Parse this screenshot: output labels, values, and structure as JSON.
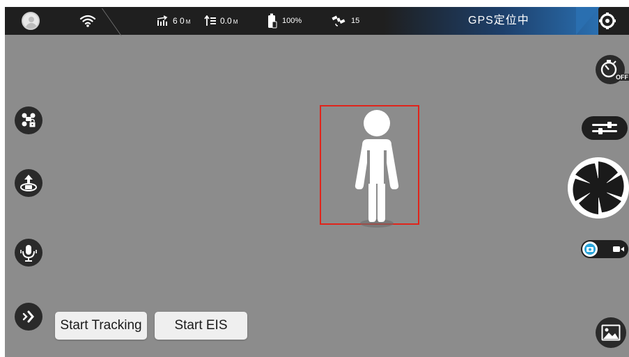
{
  "status_bar": {
    "distance": {
      "value": "6 0",
      "unit": "M",
      "icon": "horizontal-distance-icon"
    },
    "height": {
      "value": "0.0",
      "unit": "M",
      "icon": "altitude-icon"
    },
    "battery": {
      "value": "100%",
      "icon": "battery-icon"
    },
    "satellites": {
      "value": "15",
      "icon": "satellite-icon"
    },
    "gps_status": "GPS定位中",
    "icons": [
      "avatar",
      "wifi-signal-icon",
      "settings-gear-icon"
    ]
  },
  "left_controls": [
    "drone-lock-icon",
    "takeoff-landing-icon",
    "voice-control-icon",
    "expand-chevron-icon"
  ],
  "right_controls": {
    "timer_icon": "timer-icon",
    "timer_state": "OFF",
    "adjust_icon": "sliders-icon",
    "shutter_icon": "aperture-shutter-icon",
    "mode_toggle": {
      "selected": "photo",
      "icons": [
        "camera-icon",
        "video-icon"
      ]
    },
    "gallery_icon": "gallery-image-icon"
  },
  "tracking": {
    "target": "person-figure",
    "box_color": "#e0241b"
  },
  "buttons": {
    "start_tracking": "Start Tracking",
    "start_eis": "Start EIS"
  },
  "colors": {
    "background": "#8c8c8c",
    "status_bar": "#1f1f1f",
    "gps_accent": "#2a6fb0"
  }
}
